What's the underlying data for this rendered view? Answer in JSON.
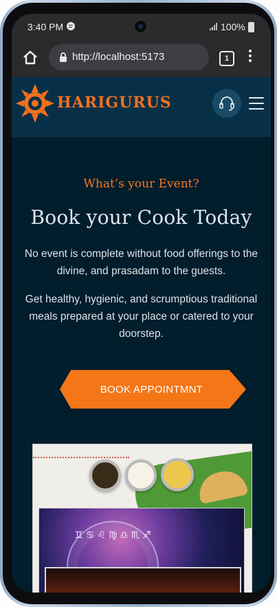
{
  "status_bar": {
    "time": "3:40 PM",
    "battery": "100%",
    "icons": [
      "spotify-icon",
      "signal-icon",
      "battery-icon"
    ]
  },
  "browser": {
    "url": "http://localhost:5173",
    "tab_count": "1",
    "icons": [
      "home-icon",
      "lock-icon",
      "tabs-icon",
      "more-vert-icon"
    ]
  },
  "header": {
    "brand": "HARIGURUS",
    "icons": [
      "sun-logo-icon",
      "headset-icon",
      "hamburger-menu-icon"
    ],
    "accent_color": "#f3701f",
    "background": "#073048"
  },
  "hero": {
    "eyebrow": "What’s your Event?",
    "title": "Book your Cook Today",
    "paragraph_1": "No event is complete without food offerings to the divine, and prasadam to the guests.",
    "paragraph_2": "Get healthy, hygienic, and scrumptious traditional meals prepared at your place or catered to your doorstep.",
    "cta_label": "BOOK APPOINTMNT",
    "cta_color": "#f47617",
    "zodiac_symbols": "♊ ♋ ♌ ♍ ♎ ♏ ♐"
  }
}
